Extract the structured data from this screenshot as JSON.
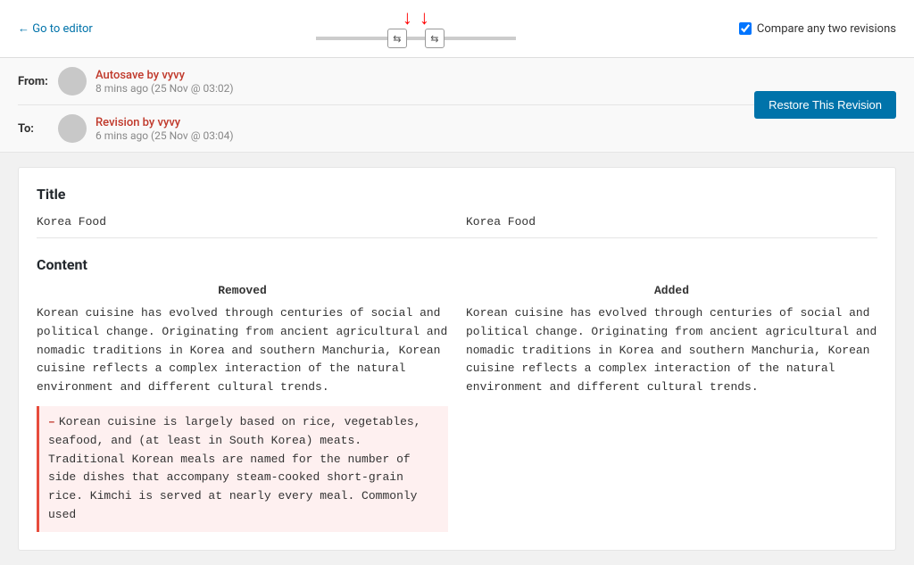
{
  "topbar": {
    "go_to_editor": "← Go to editor",
    "compare_label": "Compare any two revisions"
  },
  "revisions": {
    "from_label": "From:",
    "to_label": "To:",
    "from_author": "Autosave by vyvy",
    "from_time": "8 mins ago (25 Nov @ 03:02)",
    "to_author": "Revision by vyvy",
    "to_time": "6 mins ago (25 Nov @ 03:04)",
    "restore_button": "Restore This Revision"
  },
  "diff": {
    "title_section": "Title",
    "title_left": "Korea Food",
    "title_right": "Korea Food",
    "content_section": "Content",
    "removed_header": "Removed",
    "added_header": "Added",
    "paragraph_text": "Korean cuisine has evolved through centuries of social and political change. Originating from ancient agricultural and nomadic traditions in Korea and southern Manchuria, Korean cuisine reflects a complex interaction of the natural environment and different cultural trends.",
    "removed_text": "Korean cuisine is largely based on rice, vegetables, seafood, and (at least in South Korea) meats. Traditional Korean meals are named for the number of side dishes that accompany steam-cooked short-grain rice. Kimchi is served at nearly every meal. Commonly used"
  }
}
